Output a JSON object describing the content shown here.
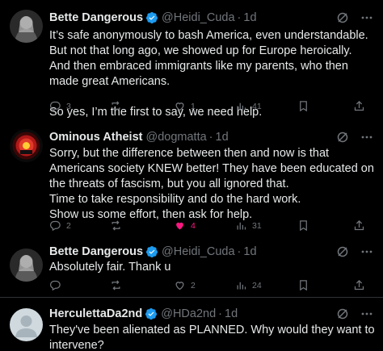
{
  "tweets": [
    {
      "name": "Bette Dangerous",
      "handle": "@Heidi_Cuda",
      "dot": "·",
      "time": "1d",
      "paragraphs": [
        "It’s safe anonymously to bash America, even understandable. But not that long ago, we showed up for Europe heroically. And then embraced immigrants like my parents, who then made great Americans.",
        "So yes, I’m the first to say, we need help."
      ],
      "replies": "3",
      "reposts": "",
      "likes": "1",
      "views": "41"
    },
    {
      "name": "Ominous Atheist",
      "handle": "@dogmatta",
      "dot": "·",
      "time": "1d",
      "paragraphs": [
        "Sorry, but the difference between then and now is that Americans society KNEW better! They have been educated on the threats of fascism, but you all ignored that.\nTime to take responsibility and do the hard work.\nShow us some effort, then ask for help."
      ],
      "replies": "2",
      "reposts": "",
      "likes": "4",
      "views": "31"
    },
    {
      "name": "Bette Dangerous",
      "handle": "@Heidi_Cuda",
      "dot": "·",
      "time": "1d",
      "paragraphs": [
        "Absolutely fair. Thank u"
      ],
      "replies": "",
      "reposts": "",
      "likes": "2",
      "views": "24"
    },
    {
      "name": "HerculettaDa2nd",
      "handle": "@HDa2nd",
      "dot": "·",
      "time": "1d",
      "paragraphs": [
        "They've been alienated as PLANNED. Why would they want to intervene?"
      ]
    }
  ],
  "colors": {
    "background": "#000000",
    "text": "#e7e9ea",
    "muted": "#71767b",
    "verified": "#1d9bf0",
    "like_active": "#f91880",
    "divider": "#2f3336"
  },
  "icons": [
    "verified-badge-icon",
    "grok-icon",
    "more-icon",
    "reply-icon",
    "repost-icon",
    "like-icon",
    "views-icon",
    "bookmark-icon",
    "share-icon"
  ]
}
